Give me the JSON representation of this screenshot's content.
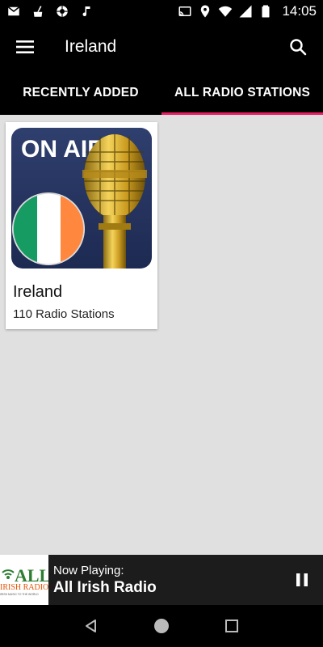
{
  "status_bar": {
    "time": "14:05",
    "left_icons": [
      "mail-icon",
      "clean-icon",
      "aperture-icon",
      "music-note-icon"
    ],
    "right_icons": [
      "cast-icon",
      "location-icon",
      "wifi-icon",
      "signal-icon",
      "battery-icon"
    ]
  },
  "app_bar": {
    "title": "Ireland",
    "menu_icon": "hamburger-menu-icon",
    "search_icon": "search-icon"
  },
  "tabs": [
    {
      "label": "RECENTLY ADDED",
      "active": false
    },
    {
      "label": "ALL RADIO STATIONS",
      "active": true
    }
  ],
  "cards": [
    {
      "title": "Ireland",
      "subtitle": "110 Radio Stations",
      "image_text": "ON AIR"
    }
  ],
  "player": {
    "label": "Now Playing:",
    "station": "All Irish Radio",
    "logo_text": "ALL",
    "logo_sub": "IRISH RADIO",
    "logo_tag": "IRISH MUSIC TO THE WORLD",
    "control_icon": "pause-icon"
  },
  "nav_bar": {
    "icons": [
      "back-icon",
      "home-icon",
      "recents-icon"
    ]
  },
  "colors": {
    "accent": "#e91e63",
    "background": "#e0e0e0",
    "bar": "#000000",
    "player": "#1c1c1c"
  }
}
